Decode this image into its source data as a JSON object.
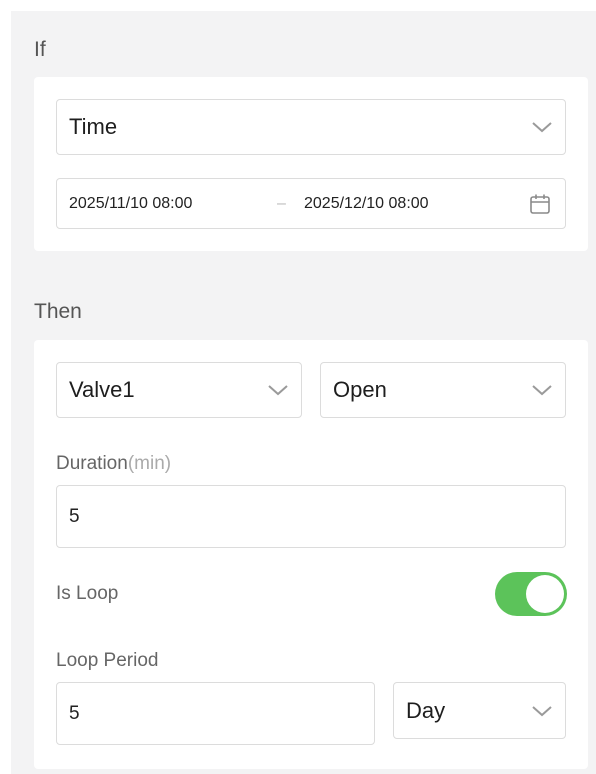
{
  "if_section": {
    "label": "If",
    "trigger_select": {
      "value": "Time"
    },
    "date_range": {
      "start": "2025/11/10 08:00",
      "separator": "–",
      "end": "2025/12/10 08:00"
    }
  },
  "then_section": {
    "label": "Then",
    "device_select": {
      "value": "Valve1"
    },
    "action_select": {
      "value": "Open"
    },
    "duration": {
      "label": "Duration",
      "unit": "(min)",
      "value": "5"
    },
    "is_loop": {
      "label": "Is Loop",
      "checked": true,
      "on_color": "#5cc35a"
    },
    "loop_period": {
      "label": "Loop Period",
      "value": "5",
      "unit_select": "Day"
    }
  },
  "icons": {
    "dropdown": "chevron-down-icon",
    "date_picker": "calendar-icon"
  }
}
